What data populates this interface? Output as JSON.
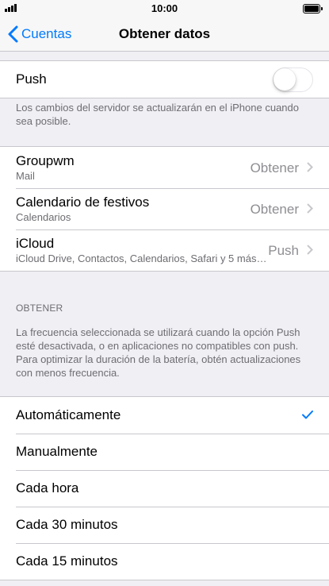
{
  "status_bar": {
    "time": "10:00"
  },
  "nav": {
    "back_label": "Cuentas",
    "title": "Obtener datos"
  },
  "push": {
    "label": "Push",
    "enabled": false,
    "footnote": "Los cambios del servidor se actualizarán en el iPhone cuando sea posible."
  },
  "accounts": [
    {
      "name": "Groupwm",
      "subtitle": "Mail",
      "value": "Obtener"
    },
    {
      "name": "Calendario de festivos",
      "subtitle": "Calendarios",
      "value": "Obtener"
    },
    {
      "name": "iCloud",
      "subtitle": "iCloud Drive, Contactos, Calendarios, Safari y 5 más…",
      "value": "Push"
    }
  ],
  "fetch": {
    "header": "OBTENER",
    "description": "La frecuencia seleccionada se utilizará cuando la opción Push esté desactivada, o en aplicaciones no compatibles con push. Para optimizar la duración de la batería, obtén actualizaciones con menos frecuencia.",
    "options": [
      {
        "label": "Automáticamente",
        "selected": true
      },
      {
        "label": "Manualmente",
        "selected": false
      },
      {
        "label": "Cada hora",
        "selected": false
      },
      {
        "label": "Cada 30 minutos",
        "selected": false
      },
      {
        "label": "Cada 15 minutos",
        "selected": false
      }
    ]
  },
  "colors": {
    "accent": "#007aff",
    "background": "#efeff4"
  }
}
